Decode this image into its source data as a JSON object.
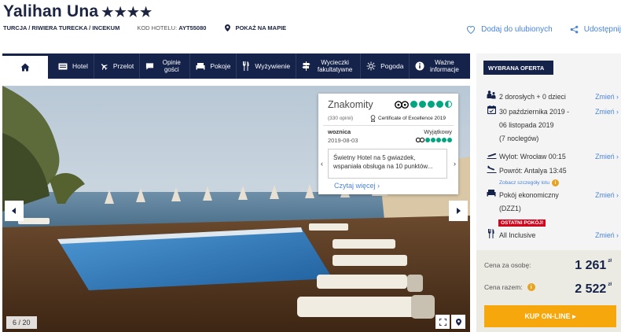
{
  "hotel": {
    "name": "Yalihan Una",
    "stars": "★★★★",
    "location": "TURCJA / RIWIERA TURECKA / INCEKUM",
    "code_label": "KOD HOTELU:",
    "code_value": "AYT55080",
    "map_link": "POKAŻ NA MAPIE"
  },
  "actions": {
    "favorites": "Dodaj do ulubionych",
    "share": "Udostępnij"
  },
  "nav": {
    "items": [
      {
        "label": "Hotel"
      },
      {
        "label": "Przelot"
      },
      {
        "label": "Opinie gości"
      },
      {
        "label": "Pokoje"
      },
      {
        "label": "Wyżywienie"
      },
      {
        "label": "Wycieczki fakultatywne"
      },
      {
        "label": "Pogoda"
      },
      {
        "label": "Ważne informacje"
      }
    ]
  },
  "gallery": {
    "counter": "6 / 20"
  },
  "review": {
    "rating_word": "Znakomity",
    "opinions": "(330 opinii)",
    "certificate": "Certificate of Excellence 2019",
    "author": "woznica",
    "date": "2019-08-03",
    "verdict": "Wyjątkowy",
    "quote": "Świetny Hotel na 5 gwiazdek, wspaniała obsługa na 10 punktów...",
    "more": "Czytaj więcej ›",
    "rating_value": 4.5,
    "rating_max": 5
  },
  "offer": {
    "header": "WYBRANA OFERTA",
    "persons": "2 dorosłych + 0 dzieci",
    "dates_line1": "30 października 2019 -",
    "dates_line2": "06 listopada 2019",
    "nights": "(7 noclegów)",
    "departure": "Wylot: Wrocław 00:15",
    "return": "Powrót: Antalya 13:45",
    "flight_details": "Zobacz szczegóły lotu",
    "room_line1": "Pokój ekonomiczny",
    "room_line2": "(DZZ1)",
    "last_rooms": "OSTATNI POKÓJ!",
    "board": "All Inclusive",
    "change": "Zmień ›",
    "price_per_person_label": "Cena za osobę:",
    "price_per_person": "1 261",
    "price_total_label": "Cena razem:",
    "price_total": "2 522",
    "currency": "zł",
    "buy": "KUP ON-LINE ▸"
  },
  "colors": {
    "navy": "#15224a",
    "link": "#4a84d6",
    "orange": "#f5a70b",
    "tripadvisor": "#00a680",
    "alert": "#d0021b"
  }
}
